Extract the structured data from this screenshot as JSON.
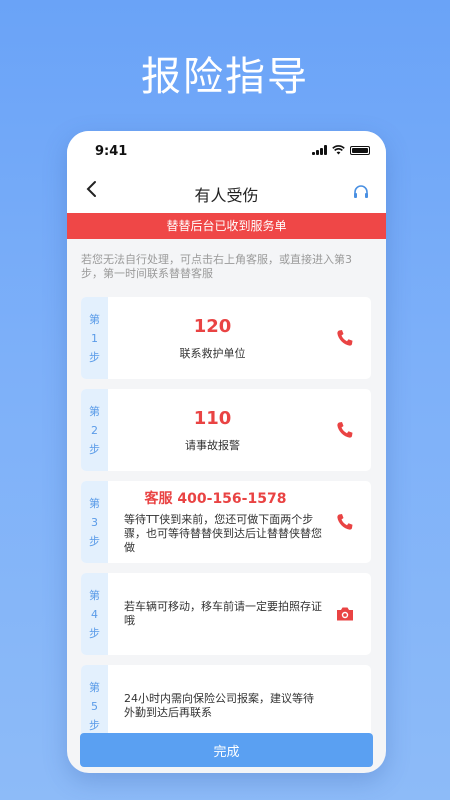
{
  "headline": "报险指导",
  "status_bar": {
    "time": "9:41"
  },
  "nav": {
    "back_icon": "chevron-left-icon",
    "title": "有人受伤",
    "support_icon": "headset-icon"
  },
  "banner": {
    "text": "替替后台已收到服务单"
  },
  "tip": {
    "text": "若您无法自行处理，可点击右上角客服，或直接进入第3步，第一时间联系替替客服"
  },
  "steps": [
    {
      "tag": [
        "第",
        "1",
        "步"
      ],
      "number": "120",
      "desc": "联系救护单位",
      "action_icon": "phone-icon"
    },
    {
      "tag": [
        "第",
        "2",
        "步"
      ],
      "number": "110",
      "desc": "请事故报警",
      "action_icon": "phone-icon"
    },
    {
      "tag": [
        "第",
        "3",
        "步"
      ],
      "number": "客服 400-156-1578",
      "desc": "等待TT侠到来前，您还可做下面两个步骤，也可等待替替侠到达后让替替侠替您做",
      "action_icon": "phone-icon"
    },
    {
      "tag": [
        "第",
        "4",
        "步"
      ],
      "desc": "若车辆可移动，移车前请一定要拍照存证哦",
      "action_icon": "camera-icon"
    },
    {
      "tag": [
        "第",
        "5",
        "步"
      ],
      "desc": "24小时内需向保险公司报案，建议等待外勤到达后再联系"
    }
  ],
  "done_button": {
    "label": "完成"
  },
  "colors": {
    "accent_red": "#ef4747",
    "accent_blue": "#5aa0f2",
    "background": "#7db0f9"
  }
}
